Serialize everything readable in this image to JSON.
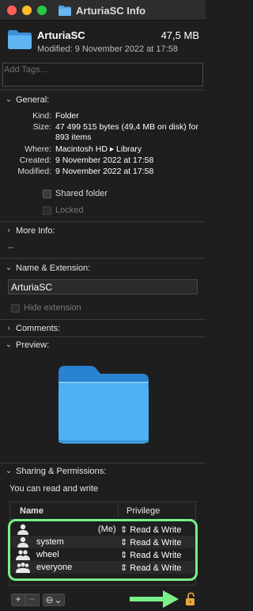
{
  "window": {
    "title": "ArturiaSC Info"
  },
  "header": {
    "name": "ArturiaSC",
    "size": "47,5 MB",
    "modified": "Modified: 9 November 2022 at 17:58",
    "icon": "folder-icon"
  },
  "tags": {
    "placeholder": "Add Tags..."
  },
  "general": {
    "label": "General:",
    "rows": [
      {
        "key": "Kind:",
        "value": "Folder"
      },
      {
        "key": "Size:",
        "value": "47 499 515 bytes (49,4 MB on disk) for 893 items"
      },
      {
        "key": "Where:",
        "value": "Macintosh HD ▸ Library"
      },
      {
        "key": "Created:",
        "value": "9 November 2022 at 17:58"
      },
      {
        "key": "Modified:",
        "value": "9 November 2022 at 17:58"
      }
    ],
    "shared_label": "Shared folder",
    "locked_label": "Locked"
  },
  "more_info": {
    "label": "More Info:",
    "value": "--"
  },
  "name_ext": {
    "label": "Name & Extension:",
    "value": "ArturiaSC",
    "hide_label": "Hide extension"
  },
  "comments": {
    "label": "Comments:"
  },
  "preview": {
    "label": "Preview:"
  },
  "sharing": {
    "label": "Sharing & Permissions:",
    "summary": "You can read and write",
    "col_name": "Name",
    "col_priv": "Privilege",
    "rows": [
      {
        "name": "",
        "me": "(Me)",
        "privilege": "⇕ Read & Write",
        "icon": "user-icon"
      },
      {
        "name": "system",
        "me": "",
        "privilege": "⇕ Read & Write",
        "icon": "user-icon"
      },
      {
        "name": "wheel",
        "me": "",
        "privilege": "⇕ Read & Write",
        "icon": "group-icon"
      },
      {
        "name": "everyone",
        "me": "",
        "privilege": "⇕ Read & Write",
        "icon": "everyone-icon"
      }
    ],
    "add": "+",
    "remove": "−",
    "action_glyph": "⊖",
    "action_chev": "⌄"
  },
  "colors": {
    "highlight": "#7bf08a",
    "folder": "#3d9eea"
  }
}
